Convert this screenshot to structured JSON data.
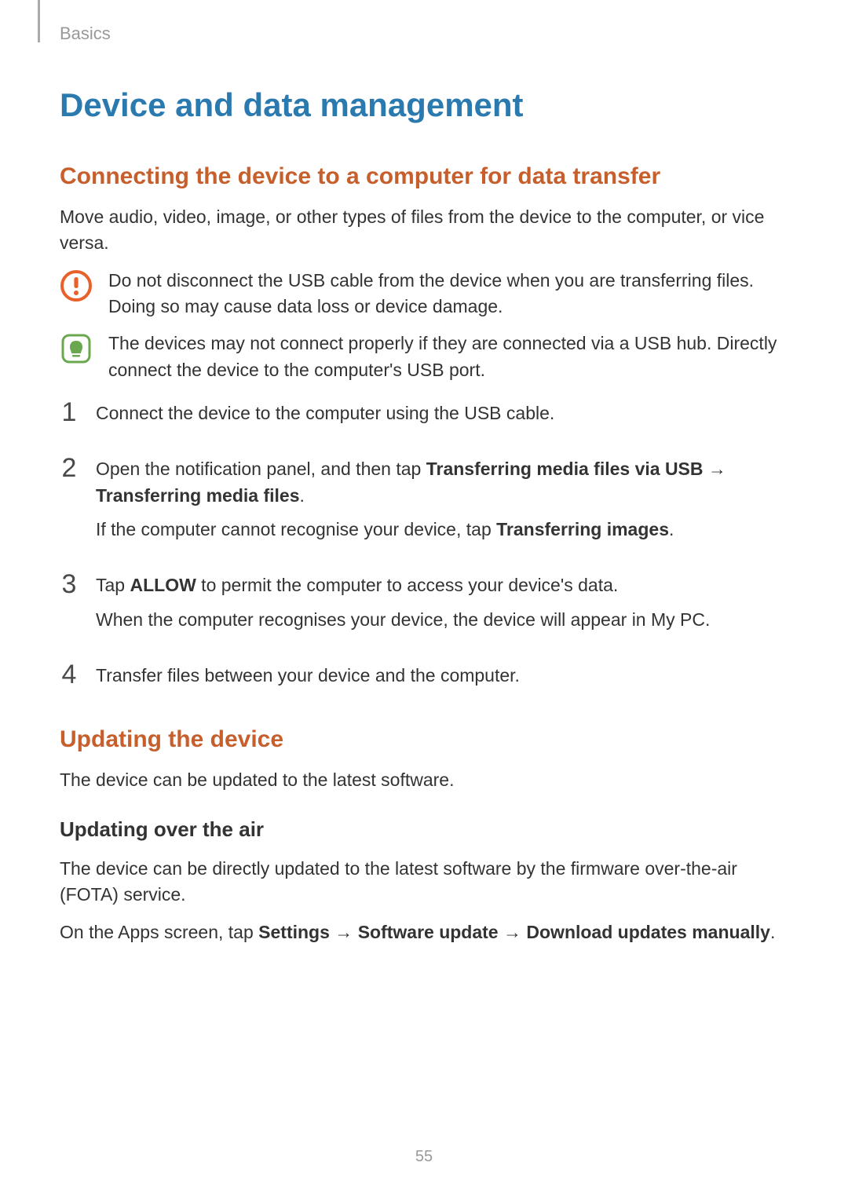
{
  "header": {
    "breadcrumb": "Basics"
  },
  "title": "Device and data management",
  "section1": {
    "heading": "Connecting the device to a computer for data transfer",
    "intro": "Move audio, video, image, or other types of files from the device to the computer, or vice versa.",
    "warning": "Do not disconnect the USB cable from the device when you are transferring files. Doing so may cause data loss or device damage.",
    "note": "The devices may not connect properly if they are connected via a USB hub. Directly connect the device to the computer's USB port.",
    "steps": {
      "s1": {
        "num": "1",
        "text": "Connect the device to the computer using the USB cable."
      },
      "s2": {
        "num": "2",
        "line1_pre": "Open the notification panel, and then tap ",
        "line1_b1": "Transferring media files via USB",
        "line1_arrow": " → ",
        "line1_b2": "Transferring media files",
        "line1_post": ".",
        "line2_pre": "If the computer cannot recognise your device, tap ",
        "line2_b": "Transferring images",
        "line2_post": "."
      },
      "s3": {
        "num": "3",
        "line1_pre": "Tap ",
        "line1_b": "ALLOW",
        "line1_post": " to permit the computer to access your device's data.",
        "line2": "When the computer recognises your device, the device will appear in My PC."
      },
      "s4": {
        "num": "4",
        "text": "Transfer files between your device and the computer."
      }
    }
  },
  "section2": {
    "heading": "Updating the device",
    "intro": "The device can be updated to the latest software.",
    "sub": {
      "heading": "Updating over the air",
      "p1": "The device can be directly updated to the latest software by the firmware over-the-air (FOTA) service.",
      "p2_pre": "On the Apps screen, tap ",
      "p2_b1": "Settings",
      "p2_a1": " → ",
      "p2_b2": "Software update",
      "p2_a2": " → ",
      "p2_b3": "Download updates manually",
      "p2_post": "."
    }
  },
  "page_number": "55"
}
